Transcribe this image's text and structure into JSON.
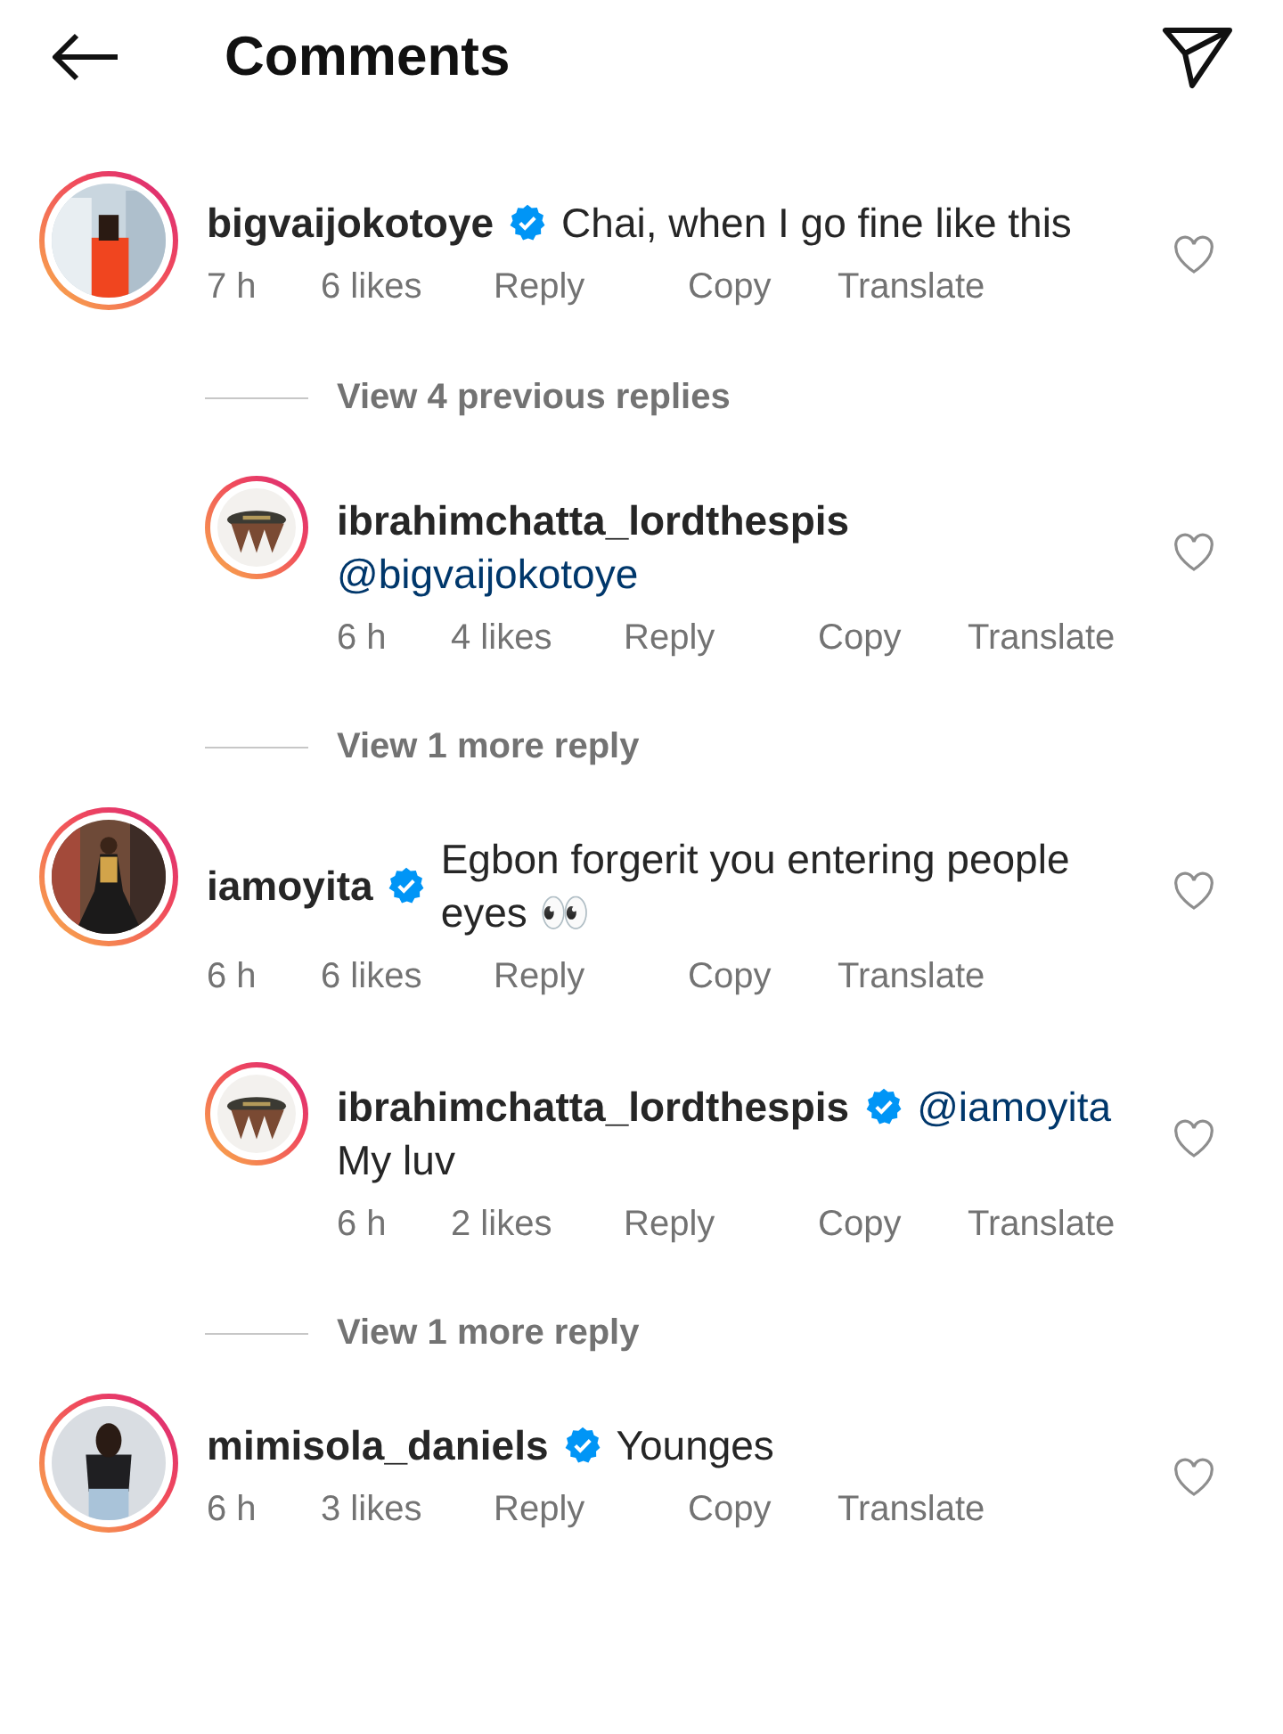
{
  "header": {
    "title": "Comments"
  },
  "items": [
    {
      "kind": "comment",
      "username": "bigvaijokotoye",
      "verified": true,
      "text": "Chai, when I go fine like this",
      "time": "7 h",
      "likes": "6 likes",
      "actions": [
        "Reply",
        "Copy",
        "Translate"
      ],
      "liked": false
    },
    {
      "kind": "view_more",
      "label": "View 4 previous replies"
    },
    {
      "kind": "reply",
      "username": "ibrahimchatta_lordthespis",
      "verified": false,
      "mention": "@bigvaijokotoye",
      "time": "6 h",
      "likes": "4 likes",
      "actions": [
        "Reply",
        "Copy",
        "Translate"
      ],
      "liked": false
    },
    {
      "kind": "view_more",
      "label": "View 1 more reply"
    },
    {
      "kind": "comment",
      "username": "iamoyita",
      "verified": true,
      "text": "Egbon forgerit you entering people eyes 👀",
      "time": "6 h",
      "likes": "6 likes",
      "actions": [
        "Reply",
        "Copy",
        "Translate"
      ],
      "liked": false
    },
    {
      "kind": "reply",
      "username": "ibrahimchatta_lordthespis",
      "verified": true,
      "mention": "@iamoyita",
      "text": "My luv",
      "time": "6 h",
      "likes": "2 likes",
      "actions": [
        "Reply",
        "Copy",
        "Translate"
      ],
      "liked": false
    },
    {
      "kind": "view_more",
      "label": "View 1 more reply"
    },
    {
      "kind": "comment",
      "username": "mimisola_daniels",
      "verified": true,
      "text": "Younges",
      "time": "6 h",
      "likes": "3 likes",
      "actions": [
        "Reply",
        "Copy",
        "Translate"
      ],
      "liked": false
    }
  ]
}
